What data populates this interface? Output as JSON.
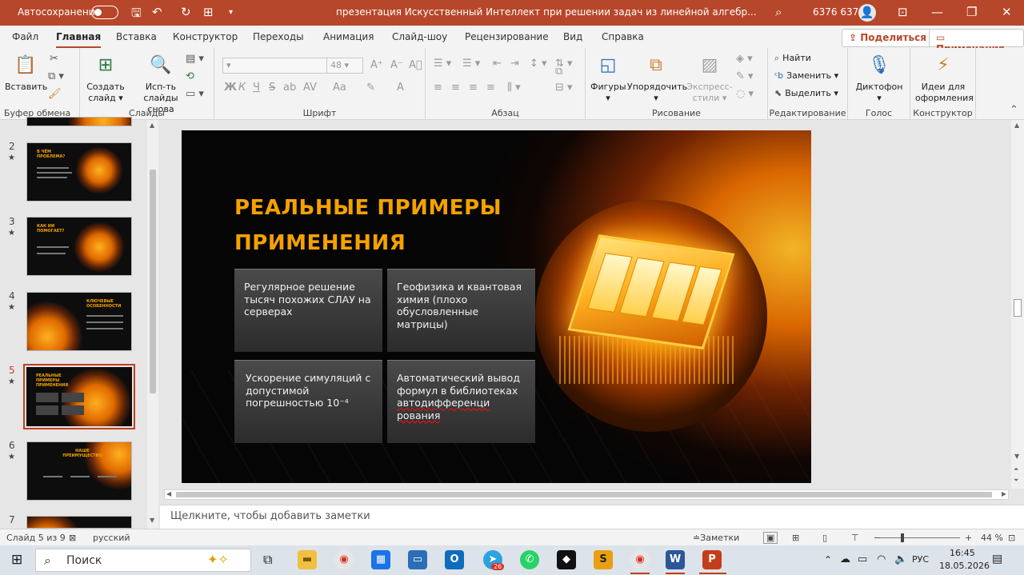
{
  "titlebar": {
    "autosave_label": "Автосохранение",
    "doc_title": "презентация Искусственный Интеллект при решении задач из линейной алгебр...",
    "user_name": "6376 6376"
  },
  "menu": {
    "tabs": [
      "Файл",
      "Главная",
      "Вставка",
      "Конструктор",
      "Переходы",
      "Анимация",
      "Слайд-шоу",
      "Рецензирование",
      "Вид",
      "Справка"
    ],
    "share_label": "Поделиться",
    "comments_label": "Примечания"
  },
  "ribbon": {
    "clipboard": {
      "paste": "Вставить",
      "group": "Буфер обмена"
    },
    "slides": {
      "new_slide": "Создать слайд",
      "reuse": "Исп-ть слайды снова",
      "group": "Слайды"
    },
    "font": {
      "size": "48",
      "group": "Шрифт",
      "bold": "Ж",
      "italic": "К",
      "underline": "Ч",
      "strike": "S",
      "spacing": "AV",
      "case": "Aa",
      "color": "A"
    },
    "paragraph": {
      "group": "Абзац"
    },
    "drawing": {
      "shapes": "Фигуры",
      "arrange": "Упорядочить",
      "styles": "Экспресс-стили",
      "group": "Рисование"
    },
    "editing": {
      "find": "Найти",
      "replace": "Заменить",
      "select": "Выделить",
      "group": "Редактирование"
    },
    "voice": {
      "dictate": "Диктофон",
      "group": "Голос"
    },
    "designer": {
      "ideas": "Идеи для оформления",
      "group": "Конструктор"
    }
  },
  "thumbnails": [
    {
      "num": "2",
      "title": "В ЧЁМ ПРОБЛЕМА?"
    },
    {
      "num": "3",
      "title": "КАК ИИ ПОМОГАЕТ?"
    },
    {
      "num": "4",
      "title": "КЛЮЧЕВЫЕ ОСОБЕННОСТИ"
    },
    {
      "num": "5",
      "title": "РЕАЛЬНЫЕ ПРИМЕРЫ ПРИМЕНЕНИЯ"
    },
    {
      "num": "6",
      "title": "НАШЕ ПРЕИМУЩЕСТВО"
    },
    {
      "num": "7",
      "title": ""
    }
  ],
  "slide": {
    "title_line1": "РЕАЛЬНЫЕ ПРИМЕРЫ",
    "title_line2": "ПРИМЕНЕНИЯ",
    "cards": [
      "Регулярное решение тысяч похожих СЛАУ на серверах",
      "Геофизика и квантовая химия (плохо обусловленные матрицы)",
      "Ускорение симуляций с допустимой погрешностью 10⁻⁴",
      "Автоматический вывод формул в библиотеках автодифференцирования"
    ],
    "card4_parts": [
      "Автоматический вывод формул в библиотеках ",
      "автодифференци рования"
    ]
  },
  "notes_placeholder": "Щелкните, чтобы добавить заметки",
  "status": {
    "slide_info": "Слайд 5 из 9",
    "language": "русский",
    "notes_btn": "Заметки",
    "zoom": "44 %"
  },
  "taskbar": {
    "search": "Поиск",
    "lang": "РУС",
    "time": "16:45",
    "date": "18.05.2026",
    "telegram_badge": "26"
  }
}
